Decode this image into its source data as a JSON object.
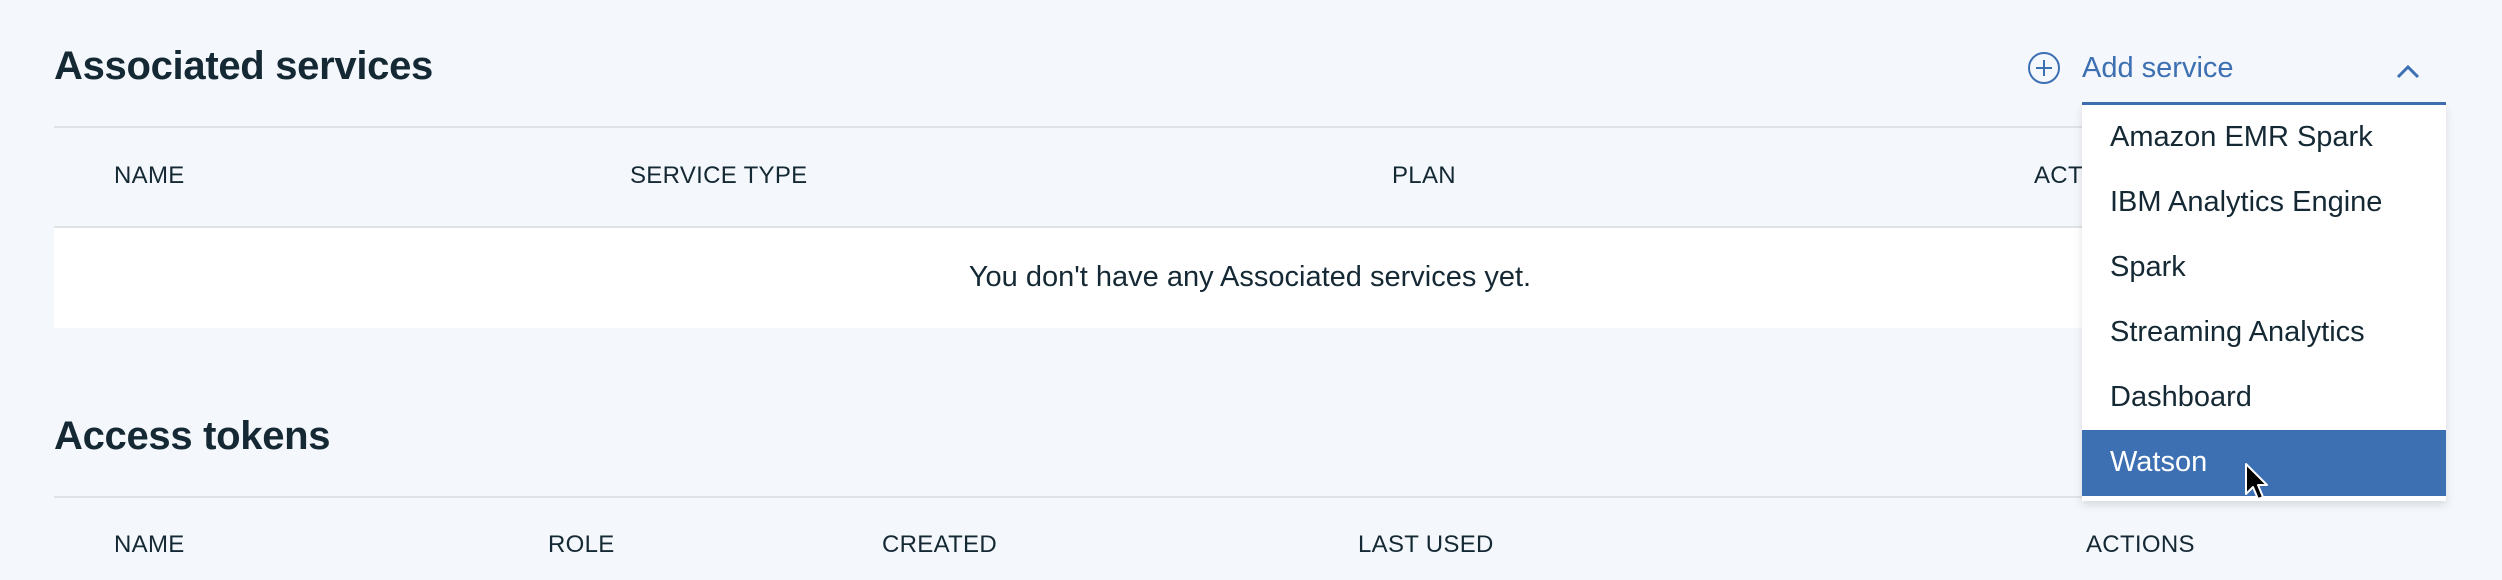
{
  "associated_services": {
    "title": "Associated services",
    "columns": [
      "NAME",
      "SERVICE TYPE",
      "PLAN",
      "ACTI"
    ],
    "empty_message": "You don't have any Associated services yet."
  },
  "add_service": {
    "label": "Add service",
    "icon": "add-circle-icon",
    "toggle_icon": "chevron-up-icon",
    "options": [
      "Amazon EMR Spark",
      "IBM Analytics Engine",
      "Spark",
      "Streaming Analytics",
      "Dashboard",
      "Watson"
    ],
    "selected": "Watson"
  },
  "access_tokens": {
    "title": "Access tokens",
    "columns": [
      "NAME",
      "ROLE",
      "CREATED",
      "LAST USED",
      "ACTIONS"
    ]
  },
  "colors": {
    "accent": "#3d70b2",
    "text": "#152935",
    "page_bg": "#f4f7fb",
    "row_bg": "#ffffff",
    "divider": "#dfe3e6"
  }
}
